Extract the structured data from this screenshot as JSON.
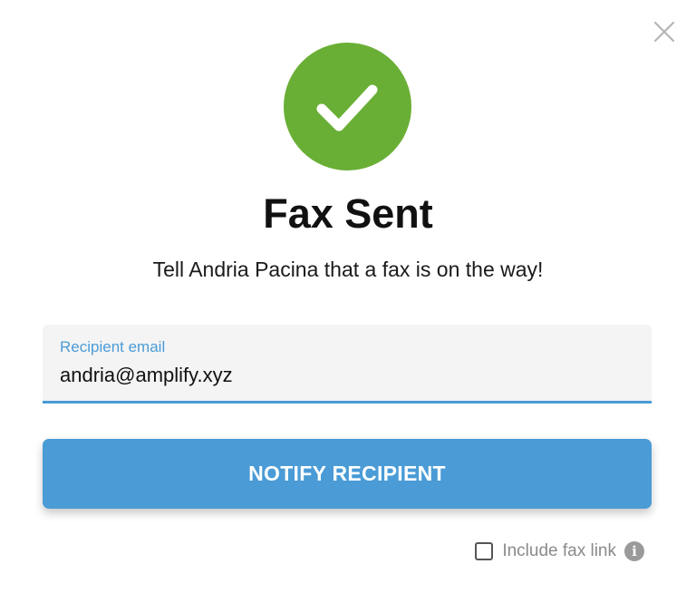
{
  "dialog": {
    "title": "Fax Sent",
    "subtitle": "Tell Andria Pacina that a fax is on the way!",
    "close_icon": "close-icon",
    "status_icon": "checkmark-icon"
  },
  "email_field": {
    "label": "Recipient email",
    "value": "andria@amplify.xyz"
  },
  "notify_button": {
    "label": "NOTIFY RECIPIENT"
  },
  "fax_link_option": {
    "label": "Include fax link",
    "checked": false,
    "info_icon": "info-icon",
    "info_glyph": "i"
  },
  "colors": {
    "success": "#6aaf35",
    "accent": "#4a9bd6",
    "field_bg": "#f4f4f4"
  }
}
